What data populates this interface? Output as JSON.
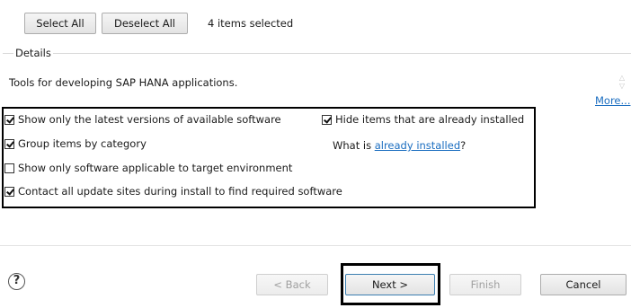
{
  "selection": {
    "select_all_label": "Select All",
    "deselect_all_label": "Deselect All",
    "selected_count_text": "4 items selected"
  },
  "details": {
    "title": "Details",
    "text": "Tools for developing SAP HANA applications.",
    "more_link": "More..."
  },
  "options": {
    "latest_versions": {
      "label": "Show only the latest versions of available software",
      "checked": true
    },
    "group_by_category": {
      "label": "Group items by category",
      "checked": true
    },
    "target_environment": {
      "label": "Show only software applicable to target environment",
      "checked": false
    },
    "contact_update_sites": {
      "label": "Contact all update sites during install to find required software",
      "checked": true
    },
    "hide_installed": {
      "label": "Hide items that are already installed",
      "checked": true
    },
    "what_is_prefix": "What is ",
    "already_installed_link": "already installed",
    "what_is_suffix": "?"
  },
  "footer": {
    "help_icon": "question-mark-circle-icon",
    "help_glyph": "?",
    "back_label": "< Back",
    "next_label": "Next >",
    "finish_label": "Finish",
    "cancel_label": "Cancel",
    "back_enabled": false,
    "finish_enabled": false
  }
}
